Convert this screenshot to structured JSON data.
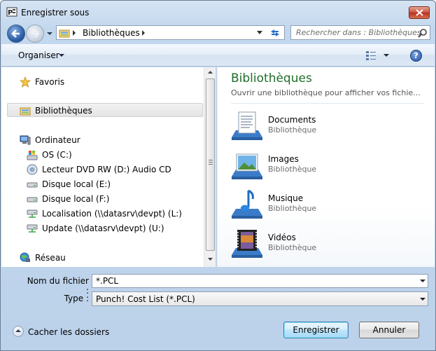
{
  "window": {
    "title": "Enregistrer sous"
  },
  "address": {
    "crumb": "Bibliothèques"
  },
  "search": {
    "placeholder": "Rechercher dans : Bibliothèques"
  },
  "toolbar": {
    "organise": "Organiser",
    "help": "?"
  },
  "nav": {
    "favorites": "Favoris",
    "libraries": "Bibliothèques",
    "computer": "Ordinateur",
    "drives": [
      {
        "label": "OS (C:)",
        "icon": "windows-drive-icon"
      },
      {
        "label": "Lecteur DVD RW (D:) Audio CD",
        "icon": "cd-drive-icon"
      },
      {
        "label": "Disque local (E:)",
        "icon": "hard-drive-icon"
      },
      {
        "label": "Disque local (F:)",
        "icon": "hard-drive-icon"
      },
      {
        "label": "Localisation (\\\\datasrv\\devpt) (L:)",
        "icon": "network-drive-icon"
      },
      {
        "label": "Update (\\\\datasrv\\devpt) (U:)",
        "icon": "network-drive-icon"
      }
    ],
    "network": "Réseau"
  },
  "content": {
    "title": "Bibliothèques",
    "subtitle": "Ouvrir une bibliothèque pour afficher vos fichie...",
    "libraries": [
      {
        "name": "Documents",
        "type": "Bibliothèque",
        "icon": "documents-library-icon"
      },
      {
        "name": "Images",
        "type": "Bibliothèque",
        "icon": "pictures-library-icon"
      },
      {
        "name": "Musique",
        "type": "Bibliothèque",
        "icon": "music-library-icon"
      },
      {
        "name": "Vidéos",
        "type": "Bibliothèque",
        "icon": "videos-library-icon"
      }
    ]
  },
  "form": {
    "filename_label": "Nom du fichier :",
    "filename_value": "*.PCL",
    "type_label": "Type :",
    "type_value": "Punch! Cost List (*.PCL)"
  },
  "footer": {
    "hide_folders": "Cacher les dossiers",
    "save": "Enregistrer",
    "cancel": "Annuler"
  },
  "colors": {
    "content_title": "#1e6e2a",
    "accent_button": "#3c7fb1"
  }
}
